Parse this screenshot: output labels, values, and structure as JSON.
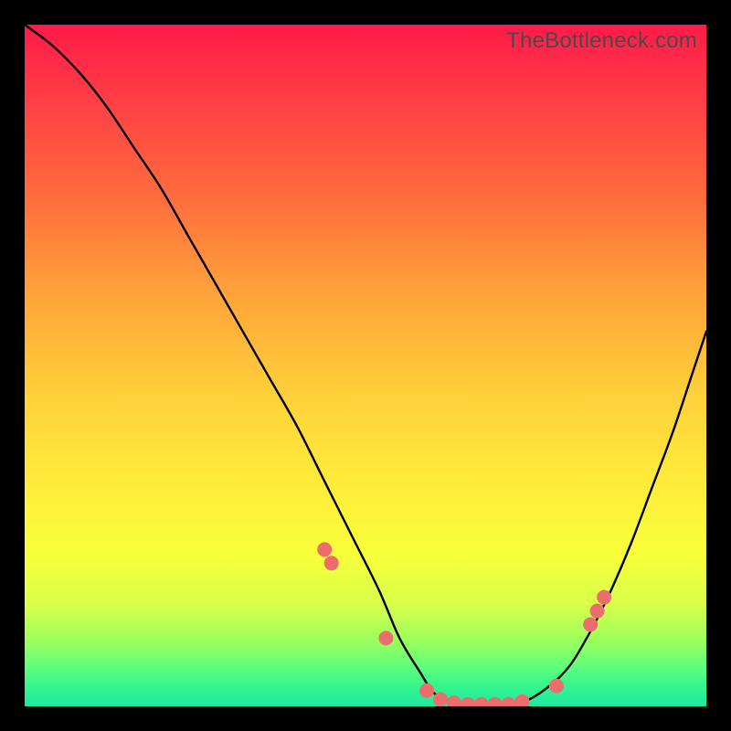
{
  "watermark": "TheBottleneck.com",
  "colors": {
    "frame": "#000000",
    "curve": "#000000",
    "marker_fill": "#ec6d6d",
    "marker_stroke": "#ec6d6d"
  },
  "chart_data": {
    "type": "line",
    "title": "",
    "xlabel": "",
    "ylabel": "",
    "xlim": [
      0,
      100
    ],
    "ylim": [
      0,
      100
    ],
    "series": [
      {
        "name": "bottleneck-curve",
        "x": [
          0,
          4,
          8,
          12,
          16,
          20,
          24,
          28,
          32,
          36,
          40,
          44,
          48,
          52,
          55,
          58,
          60,
          62,
          65,
          68,
          71,
          74,
          77,
          80,
          83,
          86,
          89,
          92,
          95,
          98,
          100
        ],
        "y": [
          100,
          97,
          93,
          88,
          82,
          76,
          69,
          62,
          55,
          48,
          41,
          33,
          25,
          17,
          10,
          5,
          2,
          1,
          0,
          0,
          0,
          1,
          3,
          6,
          11,
          17,
          24,
          32,
          40,
          49,
          55
        ]
      }
    ],
    "markers": [
      {
        "x": 44,
        "y": 23
      },
      {
        "x": 45,
        "y": 21
      },
      {
        "x": 53,
        "y": 10
      },
      {
        "x": 59,
        "y": 2.3
      },
      {
        "x": 61,
        "y": 1
      },
      {
        "x": 63,
        "y": 0.5
      },
      {
        "x": 65,
        "y": 0.3
      },
      {
        "x": 67,
        "y": 0.3
      },
      {
        "x": 69,
        "y": 0.3
      },
      {
        "x": 71,
        "y": 0.3
      },
      {
        "x": 73,
        "y": 0.7
      },
      {
        "x": 78,
        "y": 3
      },
      {
        "x": 83,
        "y": 12
      },
      {
        "x": 84,
        "y": 14
      },
      {
        "x": 85,
        "y": 16
      }
    ]
  }
}
